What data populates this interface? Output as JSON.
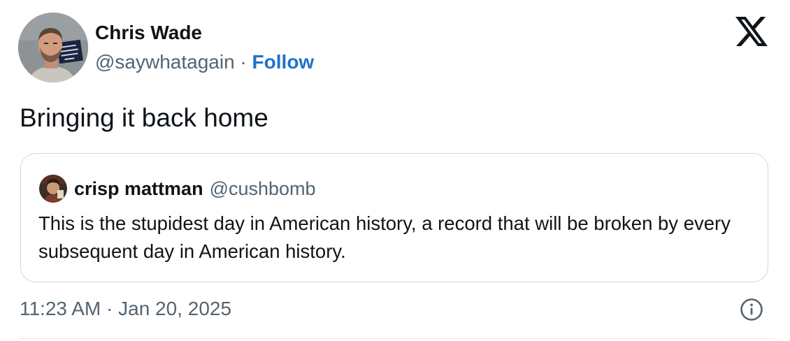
{
  "author": {
    "display_name": "Chris Wade",
    "handle": "@saywhatagain",
    "separator": " · ",
    "follow_label": "Follow"
  },
  "post": {
    "text": "Bringing it back home",
    "time": "11:23 AM",
    "separator": " · ",
    "date": "Jan 20, 2025"
  },
  "quoted_post": {
    "display_name": "crisp mattman",
    "handle": "@cushbomb",
    "text": "This is the stupidest day in American history, a record that will be broken by every subsequent day in American history."
  },
  "icons": {
    "brand": "x-logo-icon",
    "info": "info-icon"
  },
  "colors": {
    "follow": "#1d73c9",
    "secondary_text": "#536471",
    "border": "#cfd9de"
  }
}
